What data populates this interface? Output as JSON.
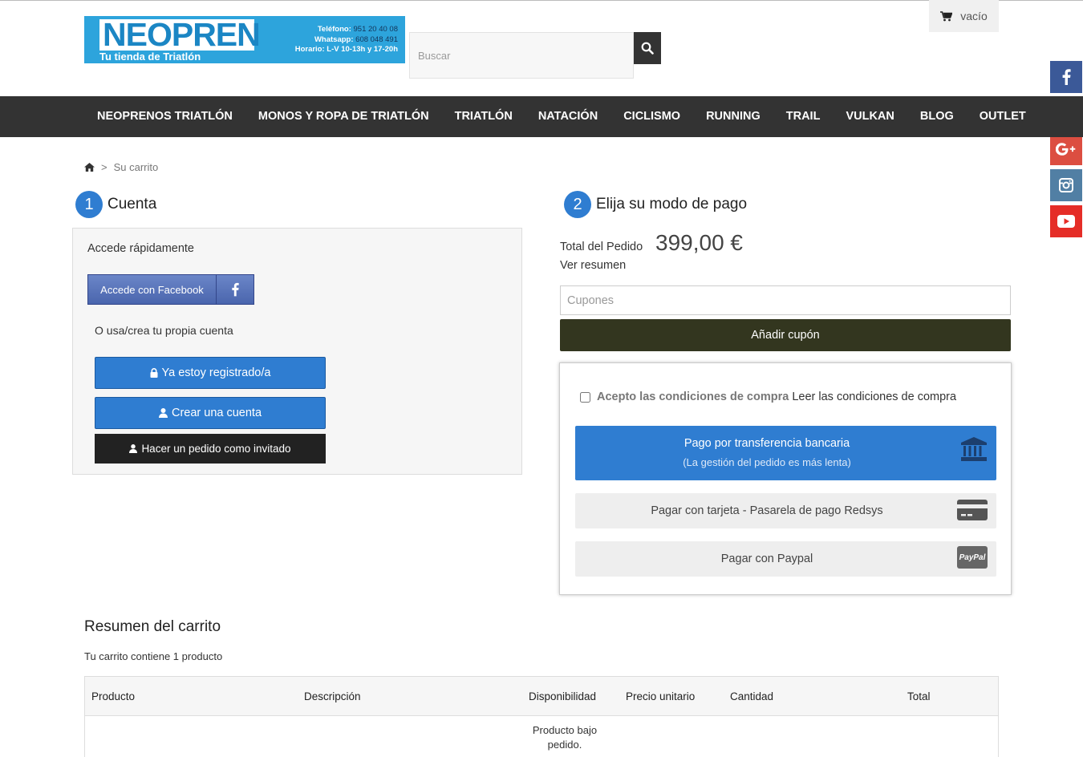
{
  "header": {
    "logo": {
      "wordmark": "NEOPREN",
      "tagline": "Tu tienda de Triatlón",
      "phone_label": "Teléfono:",
      "phone_value": "951 20 40 08",
      "whatsapp_label": "Whatsapp:",
      "whatsapp_value": "608 048 491",
      "hours": "Horario: L-V 10-13h y 17-20h"
    },
    "search_placeholder": "Buscar",
    "cart_label": "vacío"
  },
  "nav": {
    "items": [
      "NEOPRENOS TRIATLÓN",
      "MONOS Y ROPA DE TRIATLÓN",
      "TRIATLÓN",
      "NATACIÓN",
      "CICLISMO",
      "RUNNING",
      "TRAIL",
      "VULKAN",
      "BLOG",
      "OUTLET"
    ]
  },
  "breadcrumb": {
    "separator": ">",
    "current": "Su carrito"
  },
  "account": {
    "step_number": "1",
    "step_title": "Cuenta",
    "quick_title": "Accede rápidamente",
    "facebook_button": "Accede con Facebook",
    "own_account": "O usa/crea tu propia cuenta",
    "registered_button": "Ya estoy registrado/a",
    "create_button": "Crear una cuenta",
    "guest_button": "Hacer un pedido como invitado"
  },
  "payment": {
    "step_number": "2",
    "step_title": "Elija su modo de pago",
    "total_label": "Total del Pedido",
    "total_value": "399,00 €",
    "summary_link": "Ver resumen",
    "coupon_placeholder": "Cupones",
    "coupon_button": "Añadir cupón",
    "terms_accept": "Acepto las condiciones de compra",
    "terms_link": "Leer las condiciones de compra",
    "transfer_title": "Pago por transferencia bancaria",
    "transfer_note": "(La gestión del pedido es más lenta)",
    "card_option": "Pagar con tarjeta - Pasarela de pago Redsys",
    "paypal_option": "Pagar con Paypal",
    "paypal_badge": "PayPal"
  },
  "summary": {
    "title": "Resumen del carrito",
    "count_text": "Tu carrito contiene 1 producto",
    "columns": [
      "Producto",
      "Descripción",
      "Disponibilidad",
      "Precio unitario",
      "Cantidad",
      "Total"
    ],
    "availability": "Producto bajo pedido."
  },
  "colors": {
    "primary_blue": "#2f7dd1",
    "nav_dark": "#333333",
    "coupon_button": "#33361f",
    "facebook": "#3b5998",
    "twitter": "#1da1f2",
    "google_plus": "#dc4e41",
    "instagram": "#517fa4",
    "youtube": "#e52d27"
  },
  "icons": [
    "home-icon",
    "search-icon",
    "cart-icon",
    "facebook-icon",
    "twitter-icon",
    "google-plus-icon",
    "instagram-icon",
    "youtube-icon",
    "lock-icon",
    "user-icon",
    "bank-icon",
    "credit-card-icon",
    "paypal-icon"
  ]
}
